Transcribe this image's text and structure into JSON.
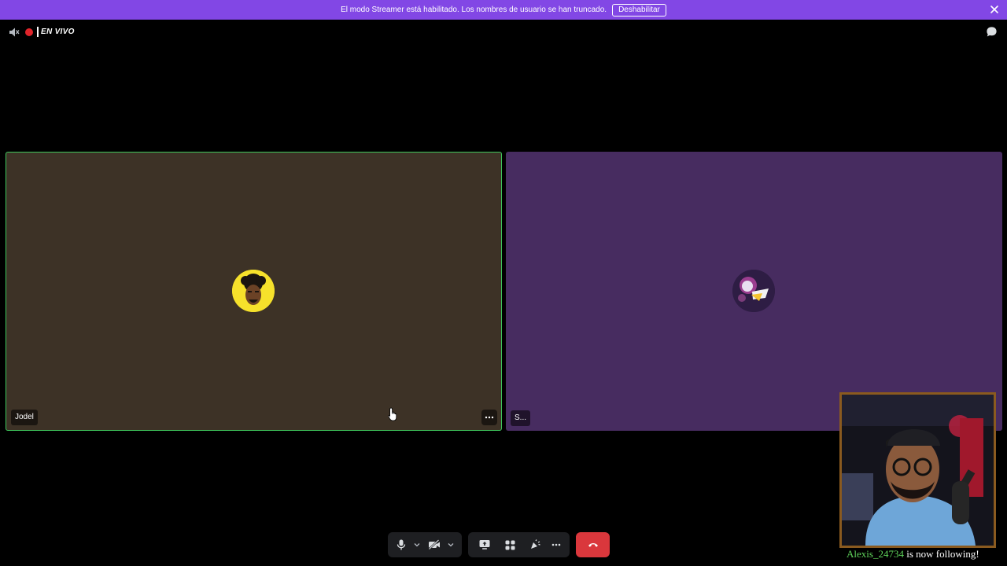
{
  "banner": {
    "message": "El modo Streamer está habilitado. Los nombres de usuario se han truncado.",
    "button_label": "Deshabilitar",
    "close_icon": "close-icon",
    "color": "#8247e5"
  },
  "topbar": {
    "live_label": "EN VIVO",
    "live_color": "#e0242a",
    "icons": [
      "speaker-muted-icon",
      "chat-bubble-icon"
    ]
  },
  "participants": [
    {
      "name": "Jodel",
      "tile_color": "#3d3226",
      "speaking": true,
      "avatar_color": "#f6e12b"
    },
    {
      "name": "S...",
      "tile_color": "#472c60",
      "speaking": false,
      "avatar_color": "#2e1d44"
    }
  ],
  "controls": {
    "icons": [
      "microphone-icon",
      "chevron-down-icon",
      "camera-off-icon",
      "chevron-down-icon",
      "screen-share-icon",
      "activities-icon",
      "soundboard-icon",
      "more-icon",
      "disconnect-icon"
    ],
    "disconnect_color": "#da373c"
  },
  "overlay": {
    "follower_name": "Alexis_24734",
    "follow_message": "is now following!",
    "follower_color": "#5fd35b"
  }
}
